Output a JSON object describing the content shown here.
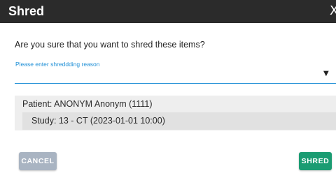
{
  "dialog": {
    "title": "Shred",
    "close_glyph": "X",
    "question": "Are you sure that you want to shred these items?",
    "reason": {
      "label": "Please enter shreddding reason",
      "value": "",
      "arrow_glyph": "▼"
    },
    "items": {
      "patient": "Patient: ANONYM Anonym (1111)",
      "study": "Study: 13 - CT (2023-01-01 10:00)"
    },
    "buttons": {
      "cancel": "CANCEL",
      "shred": "SHRED"
    }
  },
  "colors": {
    "titlebar": "#2b2b2b",
    "accent_blue": "#1e8fd6",
    "cancel_button": "#a9b4c2",
    "shred_button": "#1a9c72",
    "items_background": "#eeeeee"
  }
}
